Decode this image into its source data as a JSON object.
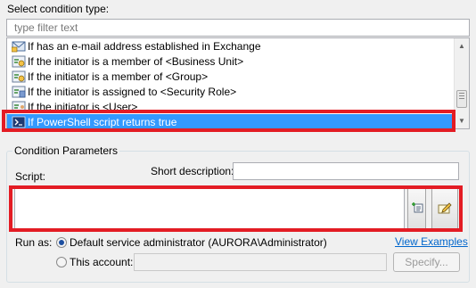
{
  "condition_type": {
    "label": "Select condition type:",
    "filter": {
      "placeholder": "type filter text",
      "value": ""
    },
    "items": [
      {
        "label": "If has an e-mail address established in Exchange",
        "icon": "exchange-condition-icon"
      },
      {
        "label": "If the initiator is a member of <Business Unit>",
        "icon": "member-condition-icon"
      },
      {
        "label": "If the initiator is a member of <Group>",
        "icon": "member-condition-icon"
      },
      {
        "label": "If the initiator is assigned to <Security Role>",
        "icon": "role-condition-icon"
      },
      {
        "label": "If the initiator is <User>",
        "icon": "user-condition-icon"
      },
      {
        "label": "If PowerShell script returns true",
        "icon": "powershell-icon",
        "selected": true
      }
    ]
  },
  "params": {
    "title": "Condition Parameters",
    "script_label": "Script:",
    "short_desc_label": "Short description:",
    "short_desc_value": "",
    "script_value": "",
    "run_as_label": "Run as:",
    "default_option": "Default service administrator (AURORA\\Administrator)",
    "default_selected": true,
    "this_account_option": "This account:",
    "account_value": "",
    "view_examples": "View Examples",
    "specify_button": "Specify..."
  },
  "colors": {
    "selection": "#3399ff",
    "highlight": "#e31c24",
    "link": "#0066cc"
  }
}
